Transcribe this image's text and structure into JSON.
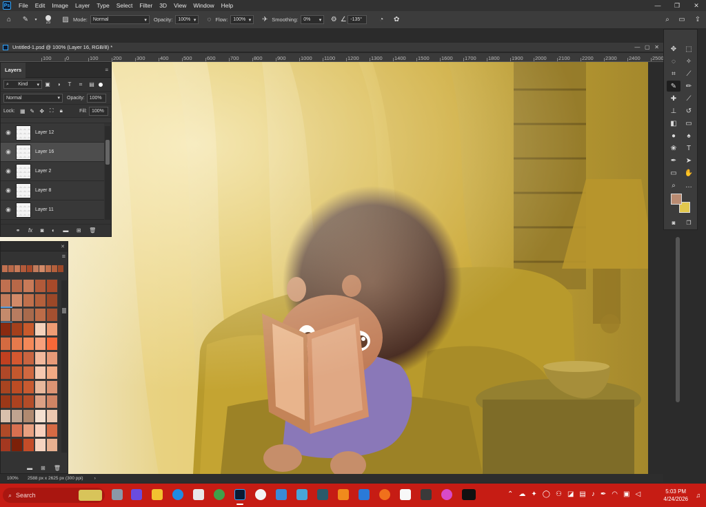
{
  "menubar": {
    "logo": "Ps",
    "items": [
      "File",
      "Edit",
      "Image",
      "Layer",
      "Type",
      "Select",
      "Filter",
      "3D",
      "View",
      "Window",
      "Help"
    ]
  },
  "options": {
    "brush_size": "25",
    "mode_label": "Mode:",
    "mode_value": "Normal",
    "opacity_label": "Opacity:",
    "opacity_value": "100%",
    "flow_label": "Flow:",
    "flow_value": "100%",
    "smoothing_label": "Smoothing:",
    "smoothing_value": "0%",
    "angle_value": "-135°"
  },
  "document": {
    "tab_title": "Untitled-1.psd @ 100% (Layer 16, RGB/8) *"
  },
  "ruler": {
    "ticks": [
      "100",
      "0",
      "100",
      "200",
      "300",
      "400",
      "500",
      "600",
      "700",
      "800",
      "900",
      "1000",
      "1100",
      "1200",
      "1300",
      "1400",
      "1500",
      "1600",
      "1700",
      "1800",
      "1900",
      "2000",
      "2100",
      "2200",
      "2300",
      "2400",
      "2500",
      "2600"
    ]
  },
  "layers_panel": {
    "tab": "Layers",
    "filter_kind": "Kind",
    "blend_mode": "Normal",
    "opacity_label": "Opacity:",
    "opacity_value": "100%",
    "lock_label": "Lock:",
    "fill_label": "Fill:",
    "fill_value": "100%",
    "layers": [
      {
        "name": "Layer 12",
        "selected": false
      },
      {
        "name": "Layer 16",
        "selected": true
      },
      {
        "name": "Layer 2",
        "selected": false
      },
      {
        "name": "Layer 8",
        "selected": false
      },
      {
        "name": "Layer 11",
        "selected": false
      }
    ]
  },
  "swatches": {
    "colors": [
      "#c07050",
      "#b86848",
      "#c87a58",
      "#b25a3a",
      "#a84a2a",
      "#c27c5c",
      "#d28a68",
      "#c0704c",
      "#b4603c",
      "#9c4828",
      "#c48a6c",
      "#b87c60",
      "#a86a4c",
      "#bc6c48",
      "#a45030",
      "#8a2a10",
      "#a4401c",
      "#c85a2c",
      "#f4d2bc",
      "#ee9c74",
      "#d46a40",
      "#e67a4c",
      "#f48858",
      "#f6a07c",
      "#f86838",
      "#c04020",
      "#d45830",
      "#c86440",
      "#f2b89c",
      "#e89a78",
      "#b04828",
      "#c4582e",
      "#d06840",
      "#f6c8b0",
      "#f2aa84",
      "#a84420",
      "#bc4c24",
      "#c85a30",
      "#e8b89c",
      "#dc9474",
      "#9c3818",
      "#ac4220",
      "#b44c28",
      "#dca084",
      "#d08464",
      "#d8c0ac",
      "#c0a490",
      "#b08a70",
      "#f4e0d0",
      "#ecc8b0",
      "#b04a28",
      "#d87050",
      "#e8a080",
      "#f8d0bc",
      "#d66a44",
      "#a43820",
      "#7c2008",
      "#c44c28",
      "#f6d4c0",
      "#e8b090"
    ]
  },
  "tools": {
    "fg_color": "#b98b72",
    "bg_color": "#e2c84e"
  },
  "status": {
    "zoom": "100%",
    "doc_size": "2588 px x 2625 px (300 ppi)"
  },
  "taskbar": {
    "search": "Search",
    "time": "5:03 PM",
    "date": "4/24/2026"
  }
}
